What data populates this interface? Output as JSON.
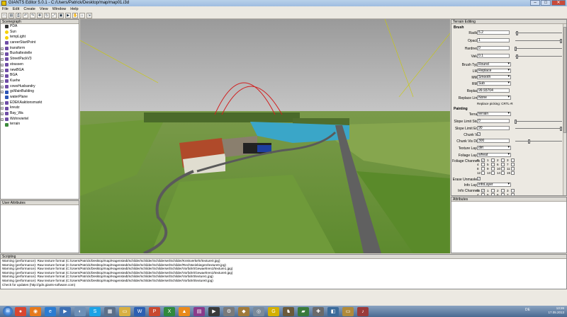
{
  "window": {
    "title": "GIANTS Editor 5.0.1 - C:/Users/Patrick/Desktop/map/map01.i3d",
    "minimize": "–",
    "maximize": "□",
    "close": "✕"
  },
  "menu": [
    "File",
    "Edit",
    "Create",
    "View",
    "Window",
    "Help"
  ],
  "toolbar_glyphs": [
    "□",
    "▤",
    "⎙",
    "↶",
    "↷",
    "✥",
    "↻",
    "⤢",
    "▣",
    "▶",
    "✋",
    "⌂",
    "⇲"
  ],
  "scenegraph": {
    "header": "Scenegraph",
    "items": [
      {
        "label": "PDA",
        "icon": "camera-icon",
        "kind": "cam",
        "expand": false
      },
      {
        "label": "Sun",
        "icon": "light-icon",
        "kind": "light",
        "expand": false
      },
      {
        "label": "tempLight",
        "icon": "light-icon",
        "kind": "light",
        "expand": false
      },
      {
        "label": "careerStartPoint",
        "icon": "transform-icon",
        "kind": "tg",
        "expand": false
      },
      {
        "label": "transform",
        "icon": "transform-icon",
        "kind": "tg",
        "expand": true
      },
      {
        "label": "Bushaltestelle",
        "icon": "transform-icon",
        "kind": "tg",
        "expand": true
      },
      {
        "label": "StreetPackV3",
        "icon": "transform-icon",
        "kind": "tg",
        "expand": true
      },
      {
        "label": "strassen",
        "icon": "transform-icon",
        "kind": "tg",
        "expand": true
      },
      {
        "label": "newBGA",
        "icon": "transform-icon",
        "kind": "tg",
        "expand": true
      },
      {
        "label": "BGA",
        "icon": "transform-icon",
        "kind": "tg",
        "expand": true
      },
      {
        "label": "Kuehe",
        "icon": "transform-icon",
        "kind": "tg",
        "expand": true
      },
      {
        "label": "cowsHusbandry",
        "icon": "transform-icon",
        "kind": "tg",
        "expand": true
      },
      {
        "label": "gcMainBuilding",
        "icon": "shape-icon",
        "kind": "shape",
        "expand": true
      },
      {
        "label": "waterPlane",
        "icon": "shape-icon",
        "kind": "shape",
        "expand": false
      },
      {
        "label": "EDEKAaktionsmarkt",
        "icon": "transform-icon",
        "kind": "tg",
        "expand": true
      },
      {
        "label": "kreutz",
        "icon": "transform-icon",
        "kind": "tg",
        "expand": true
      },
      {
        "label": "Bay_Wa",
        "icon": "transform-icon",
        "kind": "tg",
        "expand": true
      },
      {
        "label": "Wohnviertel",
        "icon": "transform-icon",
        "kind": "tg",
        "expand": true
      },
      {
        "label": "terrain",
        "icon": "terrain-icon",
        "kind": "terrain",
        "expand": false
      }
    ]
  },
  "user_attributes": {
    "header": "User Attributes"
  },
  "terrain_editing": {
    "header": "Terrain Editing",
    "brush_title": "Brush",
    "radius": {
      "label": "Radius",
      "value": "5.2",
      "slider": 0.05
    },
    "opacity": {
      "label": "Opacity",
      "value": "1",
      "slider": 0.98
    },
    "hardness": {
      "label": "Hardness",
      "value": "0",
      "slider": 0.02
    },
    "value": {
      "label": "Value",
      "value": "0.1",
      "slider": 0.05
    },
    "brush_type": {
      "label": "Brush Type",
      "value": "Round"
    },
    "lmb": {
      "label": "LMB",
      "value": "Replace"
    },
    "mmb": {
      "label": "MMB",
      "value": "Smooth"
    },
    "rmb": {
      "label": "RMB",
      "value": "Sub"
    },
    "replace": {
      "label": "Replace",
      "value": "99.93704"
    },
    "replace_limit": {
      "label": "Replace Limit",
      "value": "None"
    },
    "replace_picking": "Replace picking: CRTL-R",
    "painting_title": "Painting",
    "terrain": {
      "label": "Terrain",
      "value": "terrain"
    },
    "slope_start": {
      "label": "Slope Limit Start",
      "value": "0",
      "slider": 0.02
    },
    "slope_end": {
      "label": "Slope Limit End",
      "value": "90",
      "slider": 0.98
    },
    "chunk_vis": {
      "label": "Chunk Vis",
      "mark": "✓"
    },
    "chunk_vis_dist": {
      "label": "Chunk Vis Dist",
      "value": "300",
      "slider": 0.3
    },
    "texture_layer": {
      "label": "Texture Layer",
      "value": "dirt"
    },
    "foliage_layer": {
      "label": "Foliage Layer",
      "value": "wheat"
    },
    "foliage_channels": {
      "label": "Foliage Channels",
      "numbers": [
        "0",
        "1",
        "2",
        "3",
        "4",
        "5",
        "6",
        "7",
        "8",
        "9",
        "10",
        "11",
        "12",
        "13",
        "14",
        "15"
      ],
      "mark": "✓"
    },
    "erase_unmasked": {
      "label": "Erase Unmasked",
      "mark": "✓"
    },
    "info_layer": {
      "label": "Info Layer",
      "value": "infoLayer"
    },
    "info_channels": {
      "label": "Info Channels",
      "numbers": [
        "0",
        "1",
        "2",
        "3",
        "4",
        "5",
        "6",
        "7"
      ],
      "mark": "✓"
    }
  },
  "attributes": {
    "header": "Attributes"
  },
  "scripting": {
    "header": "Scripting",
    "lines": [
      "Warning (performance): Raw texture format (C:/Users/Patrick/Desktop/map/Hagenstedt/schilder/schilder/Schilderset/Schilder/Kreisverkehr/texture0.jpg)",
      "Warning (performance): Raw texture format (C:/Users/Patrick/Desktop/map/Hagenstedt/schilder/schilder/Schilderset/Schilder/Rechtseinbiegen/texture0.jpg)",
      "Warning (performance): Raw texture format (C:/Users/Patrick/Desktop/map/Hagenstedt/schilder/schilder/Schilderset/Schilder/Vorfahrt/Gewaehren2/texture1.jpg)",
      "Warning (performance): Raw texture format (C:/Users/Patrick/Desktop/map/Hagenstedt/schilder/schilder/Schilderset/Schilder/Vorfahrt/Gewaehren2/texture0.jpg)",
      "Warning (performance): Raw texture format (C:/Users/Patrick/Desktop/map/Hagenstedt/schilder/schilder/Schilderset/Schilder/Vorfahrt/texture1.jpg)",
      "Warning (performance): Raw texture format (C:/Users/Patrick/Desktop/map/Hagenstedt/schilder/schilder/Schilderset/Schilder/Vorfahrt/texture0.jpg)",
      "Check for updates (http://gdn.giants-software.com)"
    ]
  },
  "taskbar": {
    "start_glyph": "⊞",
    "apps": [
      {
        "name": "chrome-icon",
        "color": "#d9462f",
        "glyph": "●"
      },
      {
        "name": "firefox-icon",
        "color": "#e67a1c",
        "glyph": "◉"
      },
      {
        "name": "ie-icon",
        "color": "#2a7bd1",
        "glyph": "e"
      },
      {
        "name": "media-player-icon",
        "color": "#3d6fb3",
        "glyph": "▶"
      },
      {
        "name": "ts-icon",
        "color": "#6d8fb6",
        "glyph": "◐"
      },
      {
        "name": "skype-icon",
        "color": "#1ba3e6",
        "glyph": "S"
      },
      {
        "name": "calculator-icon",
        "color": "#5c6f88",
        "glyph": "▦"
      },
      {
        "name": "folder-icon",
        "color": "#d8b042",
        "glyph": "▭"
      },
      {
        "name": "word-icon",
        "color": "#2b5fb2",
        "glyph": "W"
      },
      {
        "name": "powerpoint-icon",
        "color": "#c9482f",
        "glyph": "P"
      },
      {
        "name": "excel-icon",
        "color": "#2f8a3d",
        "glyph": "X"
      },
      {
        "name": "vlc-icon",
        "color": "#ea8a1c",
        "glyph": "▲"
      },
      {
        "name": "winrar-icon",
        "color": "#8a3a8a",
        "glyph": "▤"
      },
      {
        "name": "media-icon",
        "color": "#3a3a3a",
        "glyph": "▶"
      },
      {
        "name": "gear-icon",
        "color": "#7a7a7a",
        "glyph": "⚙"
      },
      {
        "name": "misc-icon",
        "color": "#a07a3a",
        "glyph": "◆"
      },
      {
        "name": "disc-icon",
        "color": "#7a8a9a",
        "glyph": "◎"
      },
      {
        "name": "giants-icon",
        "color": "#d4b000",
        "glyph": "G"
      },
      {
        "name": "game-icon",
        "color": "#6a5a3a",
        "glyph": "♞"
      },
      {
        "name": "tractor-icon",
        "color": "#3a7a3a",
        "glyph": "▰"
      },
      {
        "name": "tool-icon",
        "color": "#6a6a6a",
        "glyph": "✚"
      },
      {
        "name": "app-icon",
        "color": "#3a6a9a",
        "glyph": "◧"
      },
      {
        "name": "explorer-icon",
        "color": "#b08a3a",
        "glyph": "▭"
      },
      {
        "name": "music-icon",
        "color": "#9a3a3a",
        "glyph": "♪"
      }
    ],
    "lang": "DE",
    "time": "13:26",
    "date": "17.05.2013"
  }
}
